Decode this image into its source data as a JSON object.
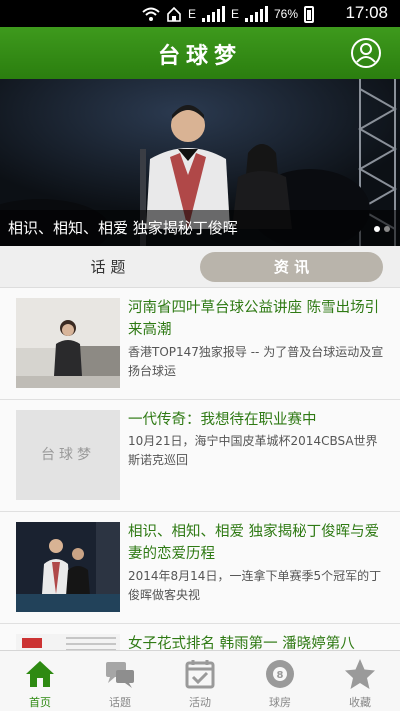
{
  "status_bar": {
    "network_badge_1": "E",
    "network_badge_2": "E",
    "battery": "76%",
    "time": "17:08"
  },
  "app_bar": {
    "title": "台球梦",
    "user_icon": "user-circle-icon"
  },
  "banner": {
    "caption": "相识、相知、相爱 独家揭秘丁俊晖",
    "slide_count": 2,
    "active_slide": 1
  },
  "tabs": [
    {
      "label": "话 题",
      "selected": false
    },
    {
      "label": "资 讯",
      "selected": true
    }
  ],
  "articles": [
    {
      "title": "河南省四叶草台球公益讲座 陈雪出场引来高潮",
      "desc": "香港TOP147独家报导 -- 为了普及台球运动及宣扬台球运"
    },
    {
      "title": "一代传奇：我想待在职业赛中",
      "desc": "10月21日，海宁中国皮革城杯2014CBSA世界斯诺克巡回",
      "placeholder_logo": "台球梦"
    },
    {
      "title": "相识、相知、相爱 独家揭秘丁俊晖与爱妻的恋爱历程",
      "desc": "2014年8月14日，一连拿下单赛季5个冠军的丁俊晖做客央视"
    },
    {
      "title": "女子花式排名 韩雨第一 潘晓婷第八",
      "desc": ""
    }
  ],
  "bottom_nav": [
    {
      "label": "首页",
      "icon": "home-icon",
      "active": true
    },
    {
      "label": "话题",
      "icon": "chat-bubbles-icon",
      "active": false
    },
    {
      "label": "活动",
      "icon": "calendar-check-icon",
      "active": false
    },
    {
      "label": "球房",
      "icon": "billiard-ball-8-icon",
      "active": false
    },
    {
      "label": "收藏",
      "icon": "star-icon",
      "active": false
    }
  ],
  "colors": {
    "brand_green": "#2e8a12",
    "title_green": "#2f7a14",
    "tab_selected_bg": "#b9b4ab"
  }
}
